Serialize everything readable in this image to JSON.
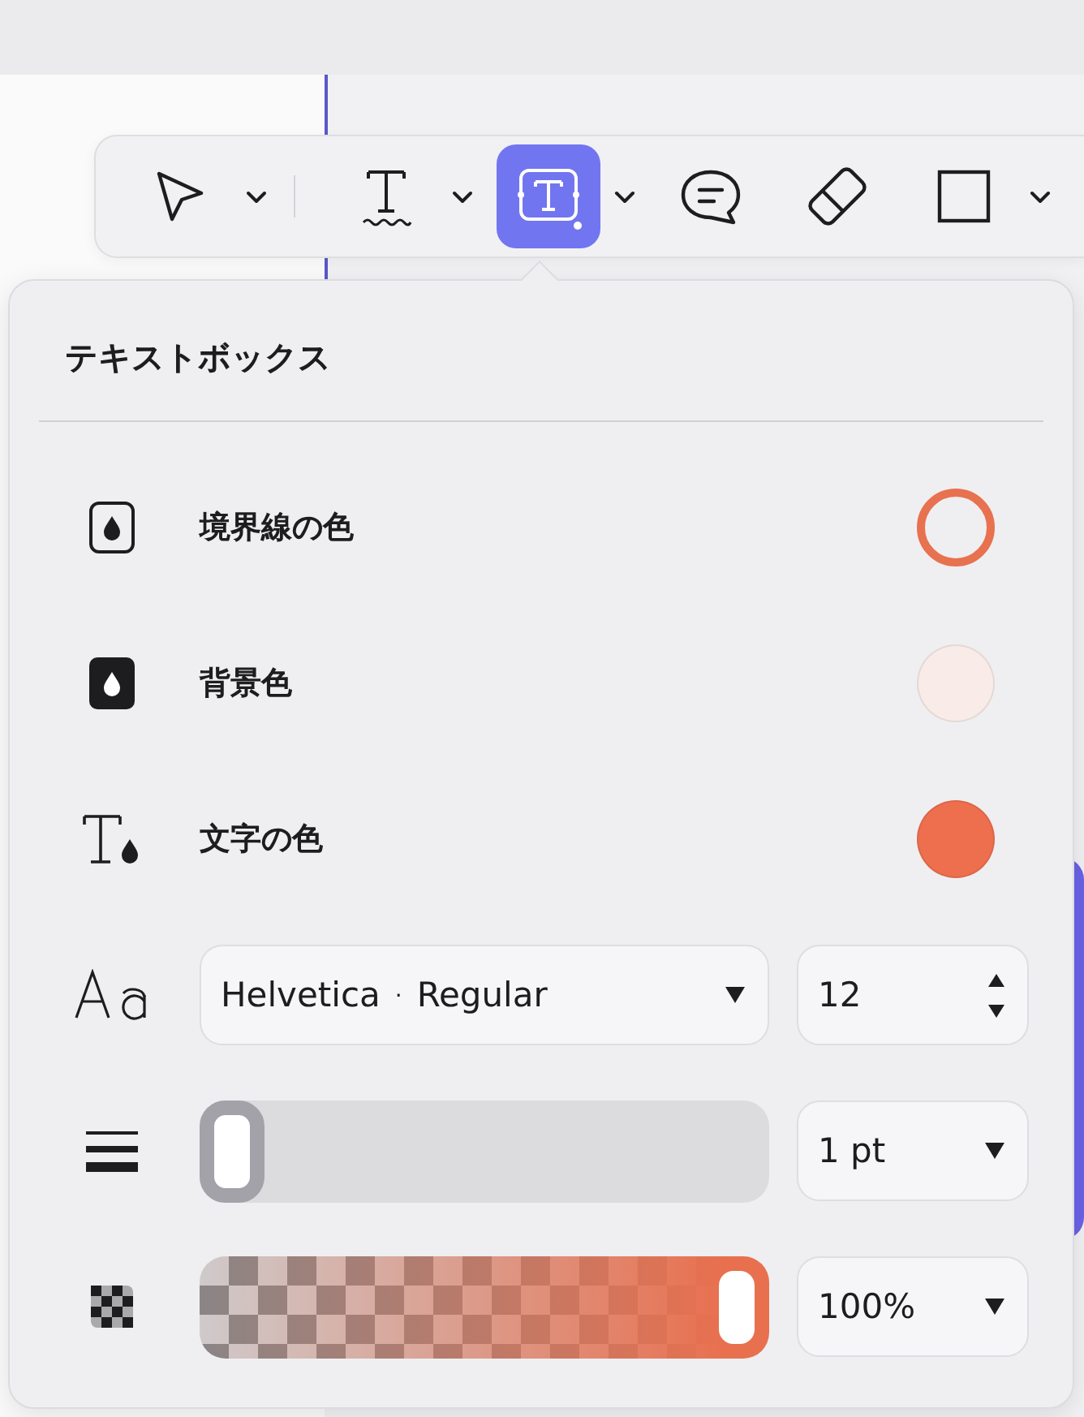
{
  "toolbar": {
    "tools": [
      {
        "kind": "pointer",
        "selected": false,
        "has_menu": true
      },
      {
        "kind": "divider"
      },
      {
        "kind": "text",
        "selected": false,
        "has_menu": true
      },
      {
        "kind": "textbox",
        "selected": true,
        "has_menu": true
      },
      {
        "kind": "comment",
        "selected": false,
        "has_menu": false
      },
      {
        "kind": "eraser",
        "selected": false,
        "has_menu": false
      },
      {
        "kind": "rectangle",
        "selected": false,
        "has_menu": true
      }
    ]
  },
  "panel": {
    "title": "テキストボックス",
    "color_rows": [
      {
        "kind": "border",
        "label": "境界線の色",
        "color": "#e8714f"
      },
      {
        "kind": "background",
        "label": "背景色",
        "color": "#f9ebe8"
      },
      {
        "kind": "text",
        "label": "文字の色",
        "color": "#ee6f4e"
      }
    ],
    "font": {
      "family": "Helvetica",
      "separator": "·",
      "style": "Regular",
      "size": "12"
    },
    "line_width": {
      "level": 0,
      "value": "1 pt"
    },
    "opacity": {
      "level": 1,
      "value": "100%",
      "color": "#e8704f"
    }
  }
}
